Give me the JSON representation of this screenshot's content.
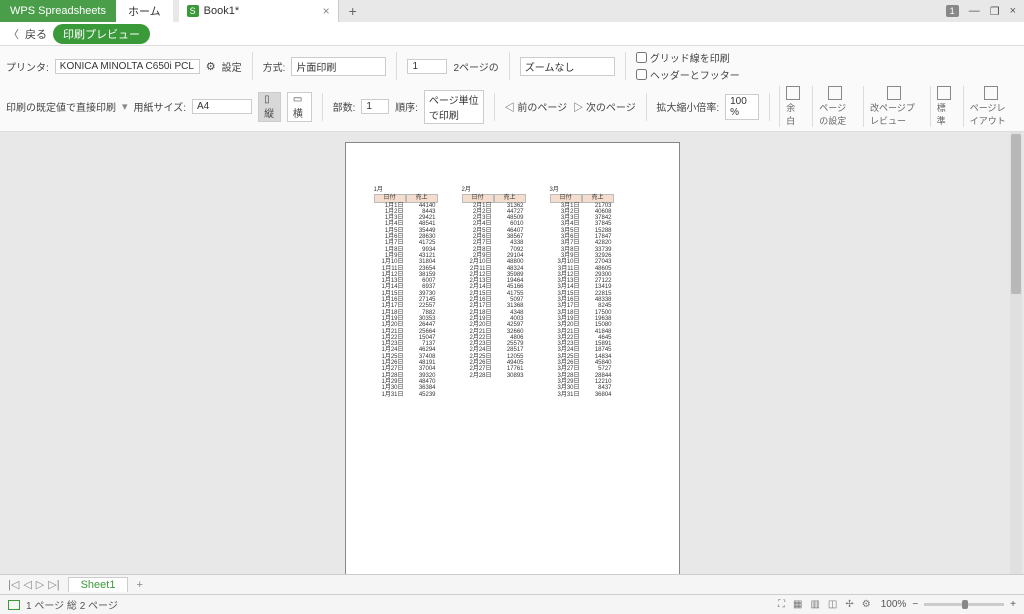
{
  "titlebar": {
    "app_name": "WPS Spreadsheets",
    "home_tab": "ホーム",
    "doc_name": "Book1*",
    "badge": "1"
  },
  "backbar": {
    "back": "戻る",
    "mode": "印刷プレビュー"
  },
  "toolbar": {
    "printer_label": "プリンタ:",
    "printer_value": "KONICA MINOLTA C650i PCL",
    "settings": "設定",
    "method_label": "方式:",
    "method_value": "片面印刷",
    "page_input": "1",
    "page_of": "2ページの",
    "zoom_label": "ズームなし",
    "print_grid": "グリッド線を印刷",
    "direct_print": "印刷の既定値で直接印刷",
    "paper_label": "用紙サイズ:",
    "paper_value": "A4",
    "orient_v": "縦",
    "orient_h": "横",
    "copies_label": "部数:",
    "copies_value": "1",
    "order_label": "順序:",
    "order_value": "ページ単位で印刷",
    "prev_page": "前のページ",
    "next_page": "次のページ",
    "zoom_ratio_label": "拡大縮小倍率:",
    "zoom_ratio_value": "100 %",
    "margin": "余白",
    "header_footer": "ヘッダーとフッター",
    "page_setup": "ページの設定",
    "page_break_preview": "改ページプレビュー",
    "normal": "標準",
    "page_layout": "ページレイアウト"
  },
  "months": [
    "1月",
    "2月",
    "3月"
  ],
  "headers": [
    "日付",
    "売上"
  ],
  "data": {
    "m1": [
      [
        "1月1日",
        "44140"
      ],
      [
        "1月2日",
        "8443"
      ],
      [
        "1月3日",
        "29421"
      ],
      [
        "1月4日",
        "48541"
      ],
      [
        "1月5日",
        "35449"
      ],
      [
        "1月6日",
        "28630"
      ],
      [
        "1月7日",
        "41725"
      ],
      [
        "1月8日",
        "9934"
      ],
      [
        "1月9日",
        "43121"
      ],
      [
        "1月10日",
        "31804"
      ],
      [
        "1月11日",
        "23654"
      ],
      [
        "1月12日",
        "38159"
      ],
      [
        "1月13日",
        "6007"
      ],
      [
        "1月14日",
        "6937"
      ],
      [
        "1月15日",
        "39730"
      ],
      [
        "1月16日",
        "27145"
      ],
      [
        "1月17日",
        "22557"
      ],
      [
        "1月18日",
        "7882"
      ],
      [
        "1月19日",
        "30353"
      ],
      [
        "1月20日",
        "26447"
      ],
      [
        "1月21日",
        "25664"
      ],
      [
        "1月22日",
        "15047"
      ],
      [
        "1月23日",
        "7137"
      ],
      [
        "1月24日",
        "46294"
      ],
      [
        "1月25日",
        "37408"
      ],
      [
        "1月26日",
        "48191"
      ],
      [
        "1月27日",
        "37004"
      ],
      [
        "1月28日",
        "39320"
      ],
      [
        "1月29日",
        "48470"
      ],
      [
        "1月30日",
        "36384"
      ],
      [
        "1月31日",
        "45239"
      ]
    ],
    "m2": [
      [
        "2月1日",
        "31362"
      ],
      [
        "2月2日",
        "44727"
      ],
      [
        "2月3日",
        "48509"
      ],
      [
        "2月4日",
        "6010"
      ],
      [
        "2月5日",
        "46407"
      ],
      [
        "2月6日",
        "38567"
      ],
      [
        "2月7日",
        "4338"
      ],
      [
        "2月8日",
        "7092"
      ],
      [
        "2月9日",
        "29104"
      ],
      [
        "2月10日",
        "48800"
      ],
      [
        "2月11日",
        "48324"
      ],
      [
        "2月12日",
        "35989"
      ],
      [
        "2月13日",
        "19464"
      ],
      [
        "2月14日",
        "45166"
      ],
      [
        "2月15日",
        "41755"
      ],
      [
        "2月16日",
        "5097"
      ],
      [
        "2月17日",
        "31368"
      ],
      [
        "2月18日",
        "4348"
      ],
      [
        "2月19日",
        "4003"
      ],
      [
        "2月20日",
        "42597"
      ],
      [
        "2月21日",
        "32660"
      ],
      [
        "2月22日",
        "4806"
      ],
      [
        "2月23日",
        "25579"
      ],
      [
        "2月24日",
        "28517"
      ],
      [
        "2月25日",
        "12055"
      ],
      [
        "2月26日",
        "49405"
      ],
      [
        "2月27日",
        "17761"
      ],
      [
        "2月28日",
        "30893"
      ]
    ],
    "m3": [
      [
        "3月1日",
        "21703"
      ],
      [
        "3月2日",
        "40608"
      ],
      [
        "3月3日",
        "37842"
      ],
      [
        "3月4日",
        "37845"
      ],
      [
        "3月5日",
        "15288"
      ],
      [
        "3月6日",
        "17847"
      ],
      [
        "3月7日",
        "42820"
      ],
      [
        "3月8日",
        "33739"
      ],
      [
        "3月9日",
        "32926"
      ],
      [
        "3月10日",
        "27043"
      ],
      [
        "3月11日",
        "48605"
      ],
      [
        "3月12日",
        "29300"
      ],
      [
        "3月13日",
        "27122"
      ],
      [
        "3月14日",
        "13419"
      ],
      [
        "3月15日",
        "22815"
      ],
      [
        "3月16日",
        "48338"
      ],
      [
        "3月17日",
        "8245"
      ],
      [
        "3月18日",
        "17500"
      ],
      [
        "3月19日",
        "19638"
      ],
      [
        "3月20日",
        "15080"
      ],
      [
        "3月21日",
        "41848"
      ],
      [
        "3月22日",
        "4645"
      ],
      [
        "3月23日",
        "15891"
      ],
      [
        "3月24日",
        "18745"
      ],
      [
        "3月25日",
        "14834"
      ],
      [
        "3月26日",
        "45840"
      ],
      [
        "3月27日",
        "5727"
      ],
      [
        "3月28日",
        "28844"
      ],
      [
        "3月29日",
        "12210"
      ],
      [
        "3月30日",
        "8437"
      ],
      [
        "3月31日",
        "36804"
      ]
    ]
  },
  "sheetbar": {
    "sheet1": "Sheet1"
  },
  "statusbar": {
    "text": "1 ページ 総 2 ページ",
    "zoom": "100%"
  }
}
